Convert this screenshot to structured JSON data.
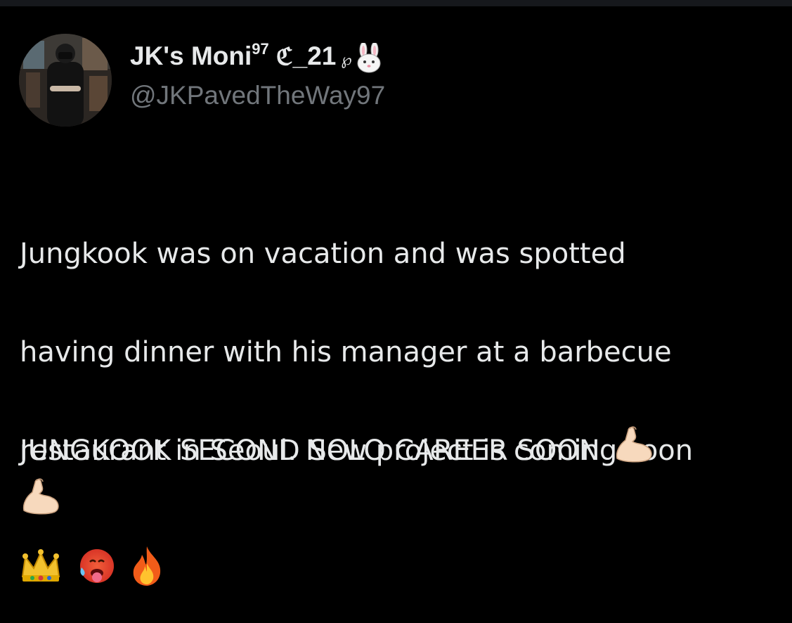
{
  "tweet": {
    "author": {
      "display_name": "JK's Moni",
      "display_sup": "97",
      "display_rune": "ℭ",
      "display_suffix": "_21",
      "display_tail": "℘",
      "handle": "@JKPavedTheWay97"
    },
    "text_lines": [
      "Jungkook was on vacation and was spotted",
      "having dinner with his manager at a barbecue",
      "restaurant in Seoul. New project is coming soon"
    ],
    "emojis": [
      "crown-icon",
      "hot-face-icon",
      "fire-icon"
    ],
    "caps_line": "JUNGKOOK SECOND SOLO CAREER SOON",
    "caps_emojis": [
      "flexed-biceps-icon",
      "flexed-biceps-icon"
    ]
  },
  "colors": {
    "background": "#000000",
    "text": "#e7e9ea",
    "handle": "#71767b"
  }
}
